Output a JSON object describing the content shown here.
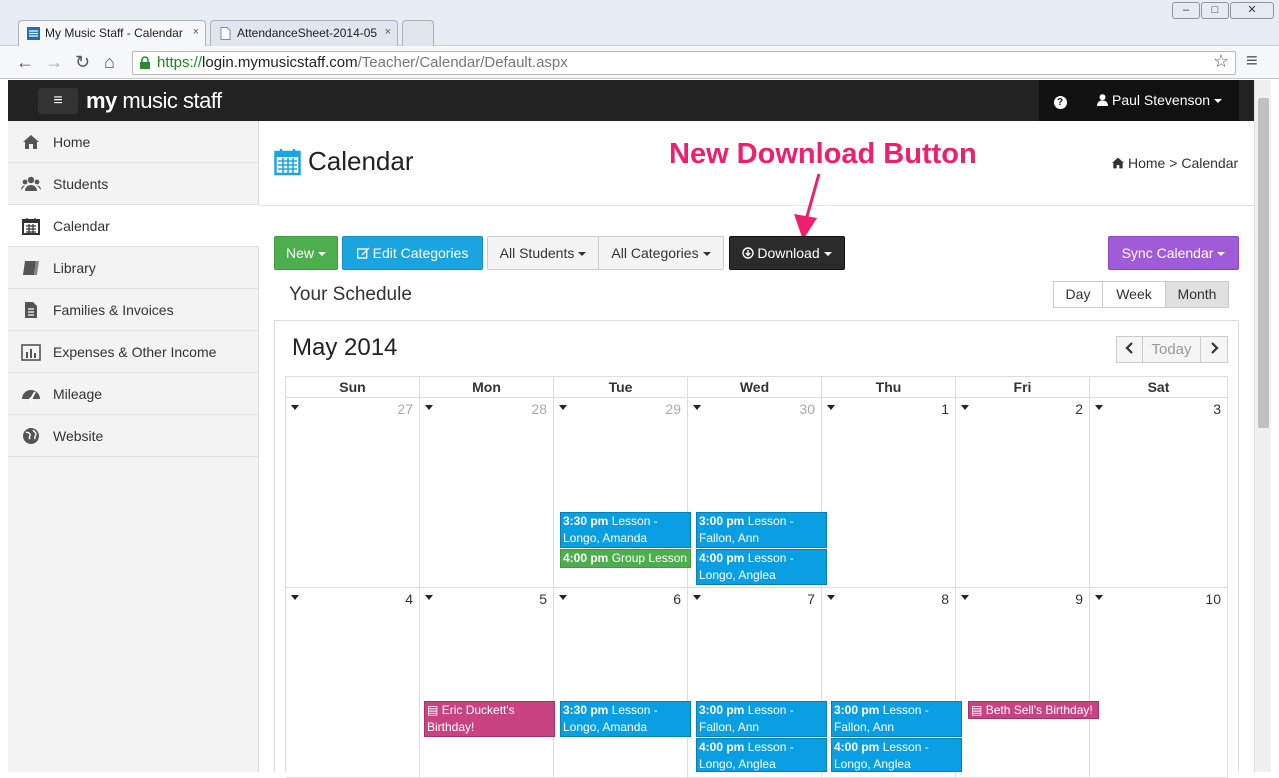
{
  "browser": {
    "tabs": [
      {
        "label": "My Music Staff - Calendar",
        "active": true
      },
      {
        "label": "AttendanceSheet-2014-05",
        "active": false
      }
    ],
    "url_proto": "https://",
    "url_host": "login.mymusicstaff.com",
    "url_path": "/Teacher/Calendar/Default.aspx",
    "window_min": "–",
    "window_max": "□",
    "window_close": "✕",
    "tab_close": "×",
    "back": "←",
    "forward": "→",
    "reload": "↻",
    "home": "⌂",
    "star": "☆",
    "menu": "≡"
  },
  "app": {
    "logo_prefix": "my",
    "logo_rest": " music staff",
    "hamburger": "≡",
    "help": "?",
    "user_name": "Paul Stevenson"
  },
  "sidebar": {
    "items": [
      {
        "label": "Home",
        "icon": "home-icon"
      },
      {
        "label": "Students",
        "icon": "users-icon"
      },
      {
        "label": "Calendar",
        "icon": "calendar-icon",
        "active": true
      },
      {
        "label": "Library",
        "icon": "book-icon"
      },
      {
        "label": "Families & Invoices",
        "icon": "file-icon"
      },
      {
        "label": "Expenses & Other Income",
        "icon": "bar-chart-icon"
      },
      {
        "label": "Mileage",
        "icon": "dashboard-icon"
      },
      {
        "label": "Website",
        "icon": "globe-icon"
      }
    ]
  },
  "page": {
    "title": "Calendar",
    "breadcrumb_home": "Home",
    "breadcrumb_sep": ">",
    "breadcrumb_current": "Calendar",
    "annotation": "New Download Button"
  },
  "toolbar": {
    "new_label": "New",
    "edit_categories": "Edit Categories",
    "all_students": "All Students",
    "all_categories": "All Categories",
    "download": "Download",
    "sync_calendar": "Sync Calendar"
  },
  "schedule": {
    "title": "Your Schedule",
    "views": [
      "Day",
      "Week",
      "Month"
    ],
    "active_view": "Month"
  },
  "calendar": {
    "month_title": "May 2014",
    "prev": "<",
    "today": "Today",
    "next": ">",
    "weekdays": [
      "Sun",
      "Mon",
      "Tue",
      "Wed",
      "Thu",
      "Fri",
      "Sat"
    ],
    "weeks": [
      [
        "27",
        "28",
        "29",
        "30",
        "1",
        "2",
        "3"
      ],
      [
        "4",
        "5",
        "6",
        "7",
        "8",
        "9",
        "10"
      ]
    ],
    "events": {
      "w1_tue_1_time": "3:30 pm",
      "w1_tue_1_text": "Lesson - Longo, Amanda",
      "w1_tue_2_time": "4:00 pm",
      "w1_tue_2_text": "Group Lesson",
      "w1_wed_1_time": "3:00 pm",
      "w1_wed_1_text": "Lesson - Fallon, Ann",
      "w1_wed_2_time": "4:00 pm",
      "w1_wed_2_text": "Lesson - Longo, Anglea",
      "w2_mon_1_text": "Eric Duckett's Birthday!",
      "w2_tue_1_time": "3:30 pm",
      "w2_tue_1_text": "Lesson - Longo, Amanda",
      "w2_wed_1_time": "3:00 pm",
      "w2_wed_1_text": "Lesson - Fallon, Ann",
      "w2_wed_2_time": "4:00 pm",
      "w2_wed_2_text": "Lesson - Longo, Anglea",
      "w2_thu_1_time": "3:00 pm",
      "w2_thu_1_text": "Lesson - Fallon, Ann",
      "w2_thu_2_time": "4:00 pm",
      "w2_thu_2_text": "Lesson - Longo, Anglea",
      "w2_fri_1_text": "Beth Sell's Birthday!"
    }
  },
  "colors": {
    "green": "#4cae4c",
    "blue": "#1ba5e0",
    "dark": "#2b2b2b",
    "purple": "#a05bd8",
    "pink": "#c94380",
    "annotation": "#ef1e6e"
  }
}
